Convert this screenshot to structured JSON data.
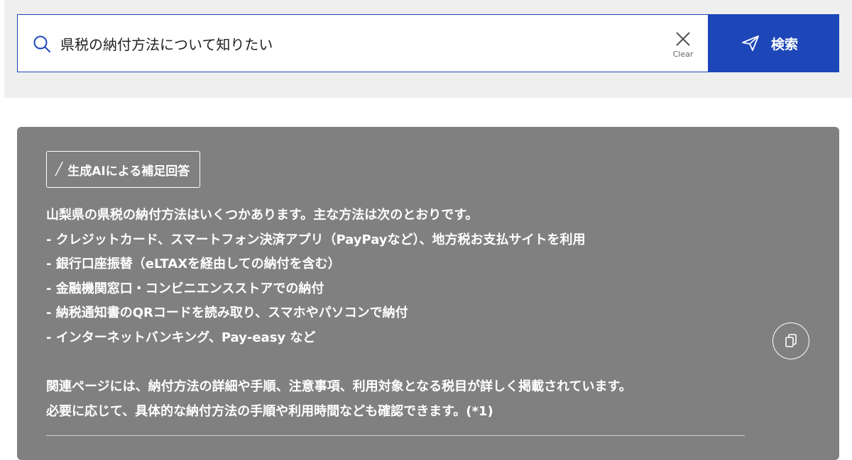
{
  "search": {
    "value": "県税の納付方法について知りたい",
    "clear_label": "Clear",
    "submit_label": "検索",
    "accent_color": "#1d47b8"
  },
  "answer": {
    "badge_label": "生成AIによる補足回答",
    "lines": [
      "山梨県の県税の納付方法はいくつかあります。主な方法は次のとおりです。",
      "- クレジットカード、スマートフォン決済アプリ（PayPayなど）、地方税お支払サイトを利用",
      "- 銀行口座振替（eLTAXを経由しての納付を含む）",
      "- 金融機関窓口・コンビニエンスストアでの納付",
      "- 納税通知書のQRコードを読み取り、スマホやパソコンで納付",
      "- インターネットバンキング、Pay-easy など"
    ],
    "summary_lines": [
      "関連ページには、納付方法の詳細や手順、注意事項、利用対象となる税目が詳しく掲載されています。",
      "必要に応じて、具体的な納付方法の手順や利用時間なども確認できます。(*1)"
    ],
    "panel_color": "#808080"
  },
  "icons": {
    "search": "search-icon",
    "clear": "close-icon",
    "submit": "send-icon",
    "copy": "copy-icon"
  }
}
